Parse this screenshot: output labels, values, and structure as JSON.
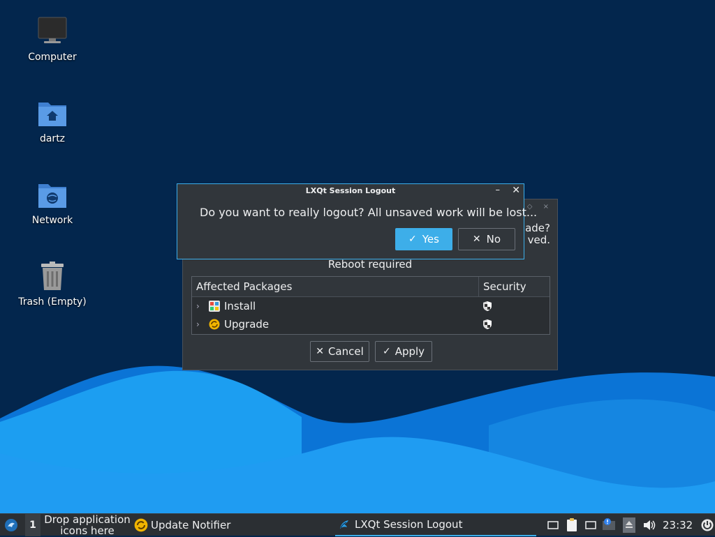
{
  "desktop": {
    "icons": [
      {
        "label": "Computer",
        "icon": "computer-icon"
      },
      {
        "label": "dartz",
        "icon": "home-folder-icon"
      },
      {
        "label": "Network",
        "icon": "network-folder-icon"
      },
      {
        "label": "Trash (Empty)",
        "icon": "trash-icon"
      }
    ]
  },
  "update_dialog": {
    "partial_line1": "ade?",
    "partial_line2": "ved.",
    "reboot_text": "Reboot required",
    "columns": [
      "Affected Packages",
      "Security"
    ],
    "rows": [
      {
        "name": "Install",
        "icon": "install-package-icon",
        "security_icon": "shield-icon"
      },
      {
        "name": "Upgrade",
        "icon": "upgrade-package-icon",
        "security_icon": "shield-icon"
      }
    ],
    "cancel_label": "Cancel",
    "apply_label": "Apply"
  },
  "logout_dialog": {
    "title": "LXQt Session Logout",
    "message": "Do you want to really logout? All unsaved work will be lost...",
    "yes_label": "Yes",
    "no_label": "No"
  },
  "taskbar": {
    "desktop_number": "1",
    "quicklaunch_line1": "Drop application",
    "quicklaunch_line2": "icons here",
    "tasks": [
      {
        "label": "Update Notifier",
        "icon": "update-notifier-icon"
      },
      {
        "label": "LXQt Session Logout",
        "icon": "lxqt-logout-icon"
      }
    ],
    "clock": "23:32"
  },
  "colors": {
    "desktop_bg": "#03264d",
    "wave_light": "#1a9cf0",
    "wave_dark": "#0a6fd1",
    "accent": "#3daee9",
    "dialog_bg": "#31363b"
  }
}
